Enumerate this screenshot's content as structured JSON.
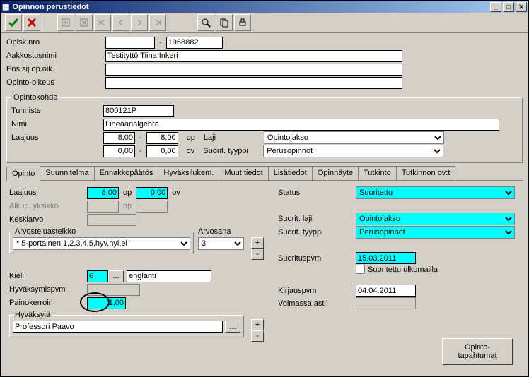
{
  "window": {
    "title": "Opinnon perustiedot"
  },
  "top": {
    "opisknro_label": "Opisk.nro",
    "opisknro_a": "",
    "opisknro_b": "1968882",
    "aakkostusnimi_label": "Aakkostusnimi",
    "aakkostusnimi": "Testityttö Tiina Inkeri",
    "enssij_label": "Ens.sij.op.oik.",
    "enssij": "",
    "opinto_oikeus_label": "Opinto-oikeus",
    "opinto_oikeus": ""
  },
  "opintokohde": {
    "legend": "Opintokohde",
    "tunniste_label": "Tunniste",
    "tunniste": "800121P",
    "nimi_label": "Nimi",
    "nimi": "Lineaarialgebra",
    "laajuus_label": "Laajuus",
    "op_min": "8,00",
    "op_max": "8,00",
    "op_u": "op",
    "ov_min": "0,00",
    "ov_max": "0,00",
    "ov_u": "ov",
    "laji_label": "Laji",
    "laji": "Opintojakso",
    "suorit_tyyppi_label": "Suorit. tyyppi",
    "suorit_tyyppi": "Perusopinnot"
  },
  "tabs": {
    "t0": "Opinto",
    "t1": "Suunnitelma",
    "t2": "Ennakkopäätös",
    "t3": "Hyväksilukem.",
    "t4": "Muut tiedot",
    "t5": "Lisätiedot",
    "t6": "Opinnäyte",
    "t7": "Tutkinto",
    "t8": "Tutkinnon ov:t"
  },
  "opinto": {
    "laajuus_label": "Laajuus",
    "laajuus_op": "8,00",
    "op_u": "op",
    "laajuus_ov": "0,00",
    "ov_u": "ov",
    "alkup_label": "Alkup. yksikkö",
    "alkup_unit": "op",
    "keskiarvo_label": "Keskiarvo",
    "keskiarvo": "",
    "arvosteluasteikko_legend": "Arvosteluasteikko",
    "asteikko": "* 5-portainen 1,2,3,4,5,hyv,hyl,ei",
    "arvosana_label": "Arvosana",
    "arvosana": "3",
    "kieli_label": "Kieli",
    "kieli_code": "6",
    "kieli_name": "englanti",
    "hyvaksymispvm_label": "Hyväksymispvm",
    "hyvaksymispvm": "",
    "painokerroin_label": "Painokerroin",
    "painokerroin": "1,00",
    "hyvaksyja_legend": "Hyväksyjä",
    "hyvaksyja": "Professori Paavo"
  },
  "right": {
    "status_label": "Status",
    "status": "Suoritettu",
    "suorit_laji_label": "Suorit. laji",
    "suorit_laji": "Opintojakso",
    "suorit_tyyppi_label": "Suorit. tyyppi",
    "suorit_tyyppi": "Perusopinnot",
    "suorituspvm_label": "Suorituspvm",
    "suorituspvm": "15.03.2011",
    "suoritettu_ulkomailla_label": "Suoritettu ulkomailla",
    "kirjauspvm_label": "Kirjauspvm",
    "kirjauspvm": "04.04.2011",
    "voimassa_label": "Voimassa asti",
    "voimassa": "",
    "opinto_tapahtumat_label": "Opinto-\ntapahtumat"
  }
}
